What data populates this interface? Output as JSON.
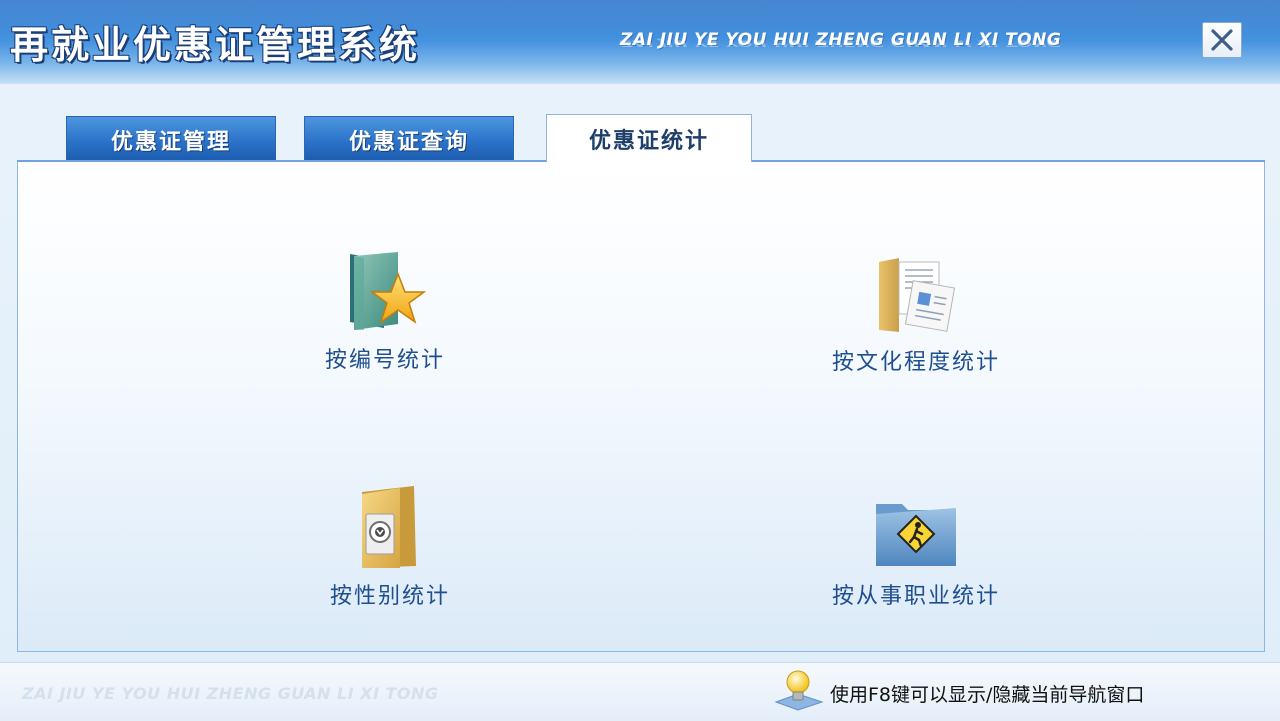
{
  "window": {
    "title_cn": "再就业优惠证管理系统",
    "title_en": "ZAI JIU YE YOU HUI ZHENG GUAN LI XI TONG",
    "close_icon": "close-icon"
  },
  "tabs": [
    {
      "label": "优惠证管理",
      "active": false
    },
    {
      "label": "优惠证查询",
      "active": false
    },
    {
      "label": "优惠证统计",
      "active": true
    }
  ],
  "features": [
    {
      "label": "按编号统计",
      "icon": "folder-star-icon"
    },
    {
      "label": "按文化程度统计",
      "icon": "folder-documents-icon"
    },
    {
      "label": "按性别统计",
      "icon": "folder-disc-icon"
    },
    {
      "label": "按从事职业统计",
      "icon": "folder-pedestrian-icon"
    }
  ],
  "footer": {
    "watermark": "ZAI JIU YE YOU HUI ZHENG GUAN LI XI TONG",
    "hint": "使用F8键可以显示/隐藏当前导航窗口",
    "hint_icon": "lightbulb-icon"
  },
  "colors": {
    "titlebar": "#2b78cf",
    "tab_inactive": "#2b73c9",
    "label_text": "#1f4f8f",
    "panel_border": "#8fb6de"
  }
}
